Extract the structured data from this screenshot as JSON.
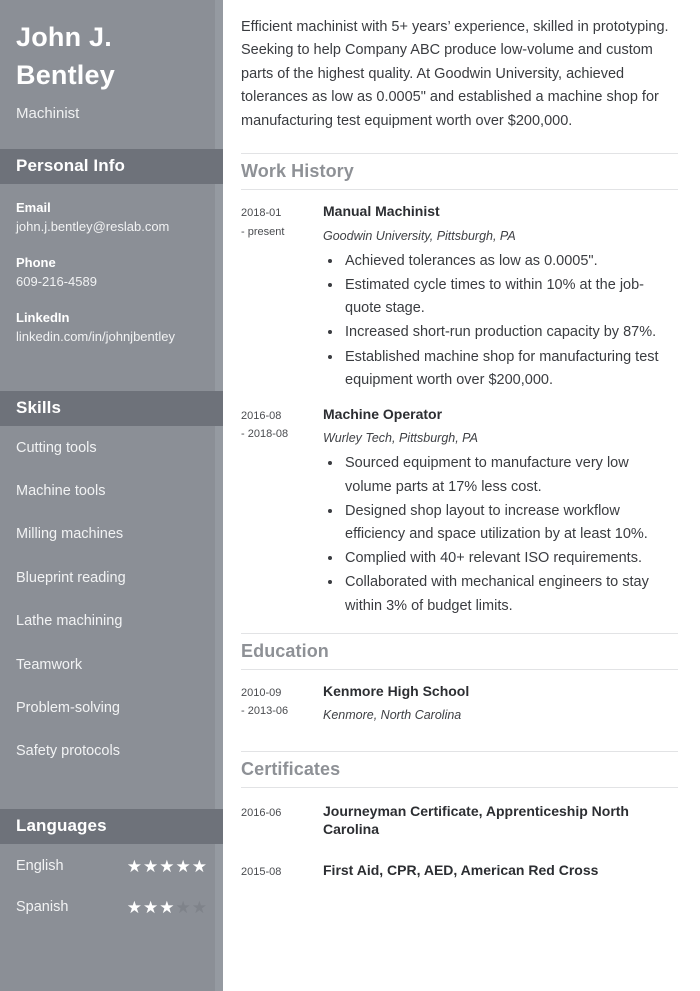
{
  "sidebar": {
    "name": "John J. Bentley",
    "job_title": "Machinist",
    "personal_info": {
      "heading": "Personal Info",
      "items": [
        {
          "label": "Email",
          "value": "john.j.bentley@reslab.com"
        },
        {
          "label": "Phone",
          "value": "609-216-4589"
        },
        {
          "label": "LinkedIn",
          "value": "linkedin.com/in/johnjbentley"
        }
      ]
    },
    "skills": {
      "heading": "Skills",
      "items": [
        "Cutting tools",
        "Machine tools",
        "Milling machines",
        "Blueprint reading",
        "Lathe machining",
        "Teamwork",
        "Problem-solving",
        "Safety protocols"
      ]
    },
    "languages": {
      "heading": "Languages",
      "items": [
        {
          "name": "English",
          "rating": 5,
          "max": 5
        },
        {
          "name": "Spanish",
          "rating": 3,
          "max": 5
        }
      ]
    }
  },
  "main": {
    "summary": "Efficient machinist with 5+ years’ experience, skilled in prototyping. Seeking to help Company ABC produce low-volume and custom parts of the highest quality. At Goodwin University, achieved tolerances as low as 0.0005\" and established a machine shop for manufacturing test equipment worth over $200,000.",
    "work_history": {
      "heading": "Work History",
      "entries": [
        {
          "date_start": "2018-01",
          "date_end": "- present",
          "title": "Manual Machinist",
          "subtitle": "Goodwin University, Pittsburgh, PA",
          "bullets": [
            "Achieved tolerances as low as 0.0005\".",
            "Estimated cycle times to within 10% at the job-quote stage.",
            "Increased short-run production capacity by 87%.",
            "Established machine shop for manufacturing test equipment worth over $200,000."
          ]
        },
        {
          "date_start": "2016-08",
          "date_end": "- 2018-08",
          "title": "Machine Operator",
          "subtitle": "Wurley Tech, Pittsburgh, PA",
          "bullets": [
            "Sourced equipment to manufacture very low volume parts at 17% less cost.",
            "Designed shop layout to increase workflow efficiency and space utilization by at least 10%.",
            "Complied with 40+ relevant ISO requirements.",
            "Collaborated with mechanical engineers to stay within 3% of budget limits."
          ]
        }
      ]
    },
    "education": {
      "heading": "Education",
      "entries": [
        {
          "date_start": "2010-09",
          "date_end": "- 2013-06",
          "title": "Kenmore High School",
          "subtitle": "Kenmore, North Carolina"
        }
      ]
    },
    "certificates": {
      "heading": "Certificates",
      "entries": [
        {
          "date_start": "2016-06",
          "title": "Journeyman Certificate, Apprenticeship North Carolina"
        },
        {
          "date_start": "2015-08",
          "title": "First Aid, CPR, AED, American Red Cross"
        }
      ]
    }
  },
  "colors": {
    "sidebar_bg": "#8b8f96",
    "sidebar_band": "#6e727a",
    "heading_grey": "#8e9196",
    "body_text": "#3a3c40",
    "star_filled": "#ffffff",
    "star_empty": "#7f838a"
  }
}
